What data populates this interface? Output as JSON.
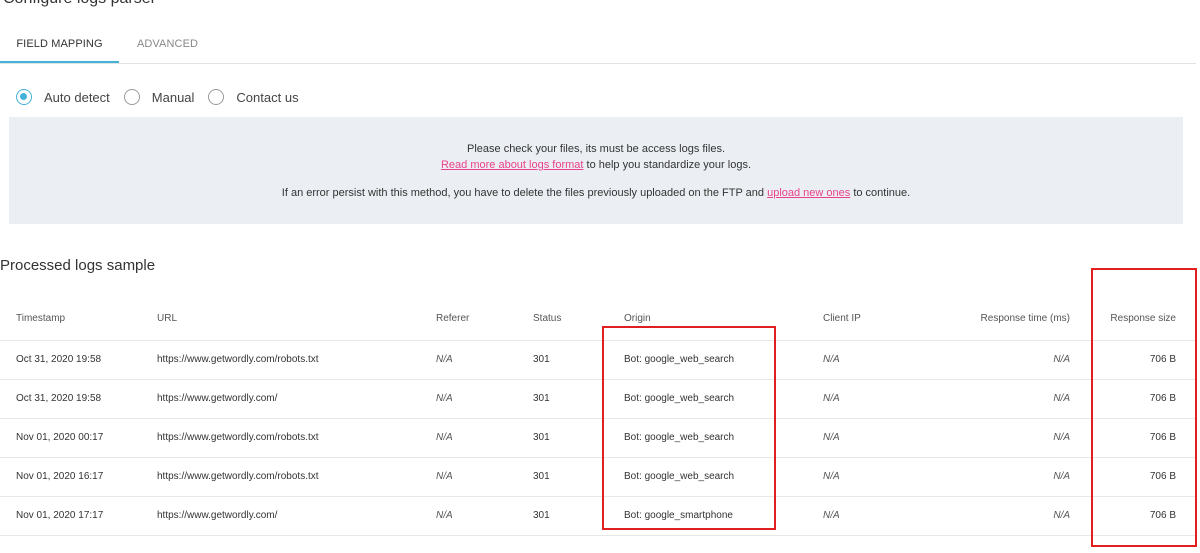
{
  "page": {
    "heading": "Configure logs parser"
  },
  "tabs": [
    {
      "label": "FIELD MAPPING",
      "active": true
    },
    {
      "label": "ADVANCED",
      "active": false
    }
  ],
  "radios": [
    {
      "label": "Auto detect",
      "checked": true
    },
    {
      "label": "Manual",
      "checked": false
    },
    {
      "label": "Contact us",
      "checked": false
    }
  ],
  "info": {
    "line1": "Please check your files, its must be access logs files.",
    "line2_link": "Read more about logs format",
    "line2_text": " to help you standardize your logs.",
    "line3_pre": "If an error persist with this method, you have to delete the files previously uploaded on the FTP and ",
    "line3_link": "upload new ones",
    "line3_post": " to continue."
  },
  "section": {
    "title": "Processed logs sample"
  },
  "table": {
    "headers": [
      "Timestamp",
      "URL",
      "Referer",
      "Status",
      "Origin",
      "Client IP",
      "Response time (ms)",
      "Response size"
    ],
    "rows": [
      [
        "Oct 31, 2020 19:58",
        "https://www.getwordly.com/robots.txt",
        "N/A",
        "301",
        "Bot: google_web_search",
        "N/A",
        "N/A",
        "706 B"
      ],
      [
        "Oct 31, 2020 19:58",
        "https://www.getwordly.com/",
        "N/A",
        "301",
        "Bot: google_web_search",
        "N/A",
        "N/A",
        "706 B"
      ],
      [
        "Nov 01, 2020 00:17",
        "https://www.getwordly.com/robots.txt",
        "N/A",
        "301",
        "Bot: google_web_search",
        "N/A",
        "N/A",
        "706 B"
      ],
      [
        "Nov 01, 2020 16:17",
        "https://www.getwordly.com/robots.txt",
        "N/A",
        "301",
        "Bot: google_web_search",
        "N/A",
        "N/A",
        "706 B"
      ],
      [
        "Nov 01, 2020 17:17",
        "https://www.getwordly.com/",
        "N/A",
        "301",
        "Bot: google_smartphone",
        "N/A",
        "N/A",
        "706 B"
      ]
    ]
  },
  "colors": {
    "accent": "#43b2d9",
    "link": "#e8428b",
    "highlight": "#e02020",
    "info_bg": "#ebeff3"
  }
}
